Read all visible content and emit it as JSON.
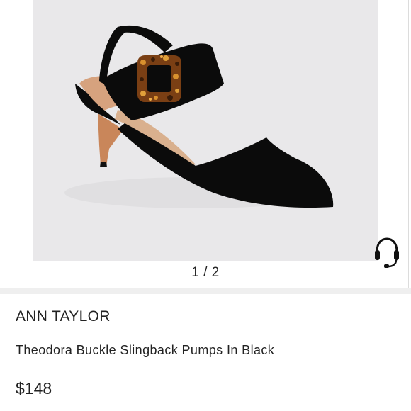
{
  "gallery": {
    "position_label": "1 / 2",
    "image_icon": "shoe-photo"
  },
  "support": {
    "icon": "headset-icon"
  },
  "product": {
    "brand": "ANN TAYLOR",
    "title": "Theodora Buckle Slingback Pumps In Black",
    "price": "$148"
  },
  "colors": {
    "image_background": "#e9e8ea",
    "shoe": "#0b0b0b",
    "heel": "#c9865a",
    "text": "#222222"
  }
}
